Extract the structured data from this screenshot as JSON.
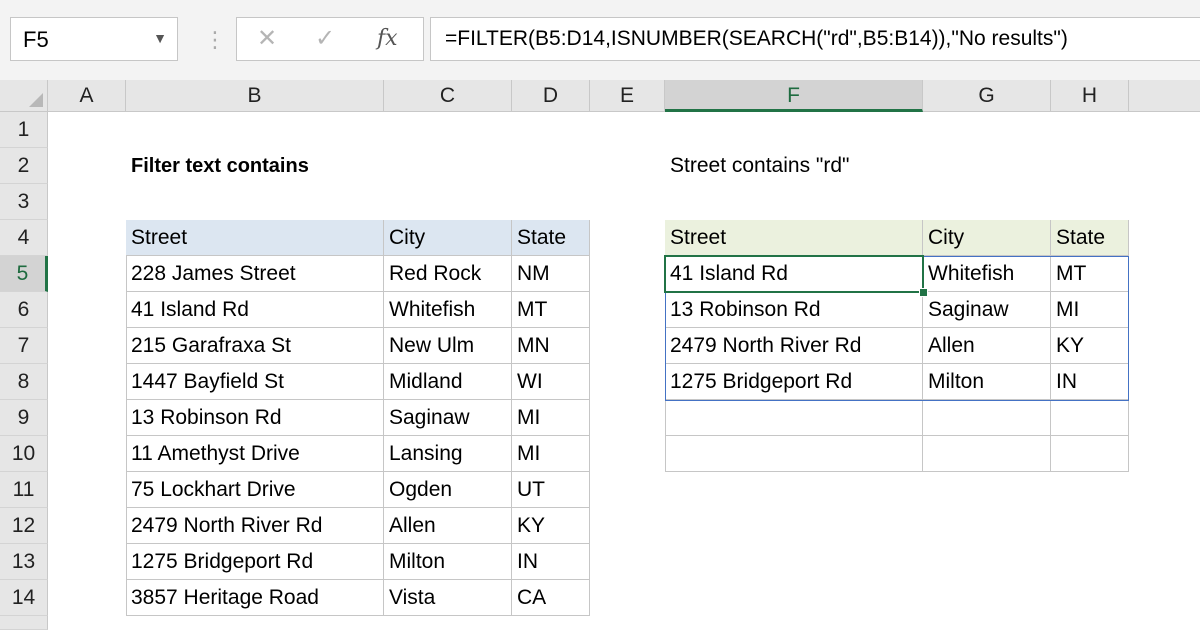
{
  "formula_bar": {
    "name_box": "F5",
    "cancel_icon": "✕",
    "enter_icon": "✓",
    "fx_label": "fx",
    "formula": "=FILTER(B5:D14,ISNUMBER(SEARCH(\"rd\",B5:B14)),\"No results\")"
  },
  "columns": [
    "A",
    "B",
    "C",
    "D",
    "E",
    "F",
    "G",
    "H"
  ],
  "rows": [
    "1",
    "2",
    "3",
    "4",
    "5",
    "6",
    "7",
    "8",
    "9",
    "10",
    "11",
    "12",
    "13",
    "14"
  ],
  "sheet": {
    "title": "Filter text contains",
    "subtitle": "Street contains \"rd\""
  },
  "source_table": {
    "headers": [
      "Street",
      "City",
      "State"
    ],
    "rows": [
      [
        "228 James Street",
        "Red Rock",
        "NM"
      ],
      [
        "41 Island Rd",
        "Whitefish",
        "MT"
      ],
      [
        "215 Garafraxa St",
        "New Ulm",
        "MN"
      ],
      [
        "1447 Bayfield St",
        "Midland",
        "WI"
      ],
      [
        "13 Robinson Rd",
        "Saginaw",
        "MI"
      ],
      [
        "11 Amethyst Drive",
        "Lansing",
        "MI"
      ],
      [
        "75 Lockhart Drive",
        "Ogden",
        "UT"
      ],
      [
        "2479 North River Rd",
        "Allen",
        "KY"
      ],
      [
        "1275 Bridgeport Rd",
        "Milton",
        "IN"
      ],
      [
        "3857 Heritage Road",
        "Vista",
        "CA"
      ]
    ]
  },
  "result_table": {
    "headers": [
      "Street",
      "City",
      "State"
    ],
    "rows": [
      [
        "41 Island Rd",
        "Whitefish",
        "MT"
      ],
      [
        "13 Robinson Rd",
        "Saginaw",
        "MI"
      ],
      [
        "2479 North River Rd",
        "Allen",
        "KY"
      ],
      [
        "1275 Bridgeport Rd",
        "Milton",
        "IN"
      ],
      [
        "",
        "",
        ""
      ],
      [
        "",
        "",
        ""
      ]
    ]
  },
  "selection": {
    "active_cell": "F5",
    "active_column": "F",
    "active_row": "5"
  },
  "colors": {
    "excel_green": "#217346",
    "spill_blue": "#4472c4",
    "header_blue": "#dce6f1",
    "header_green": "#ebf1de"
  }
}
